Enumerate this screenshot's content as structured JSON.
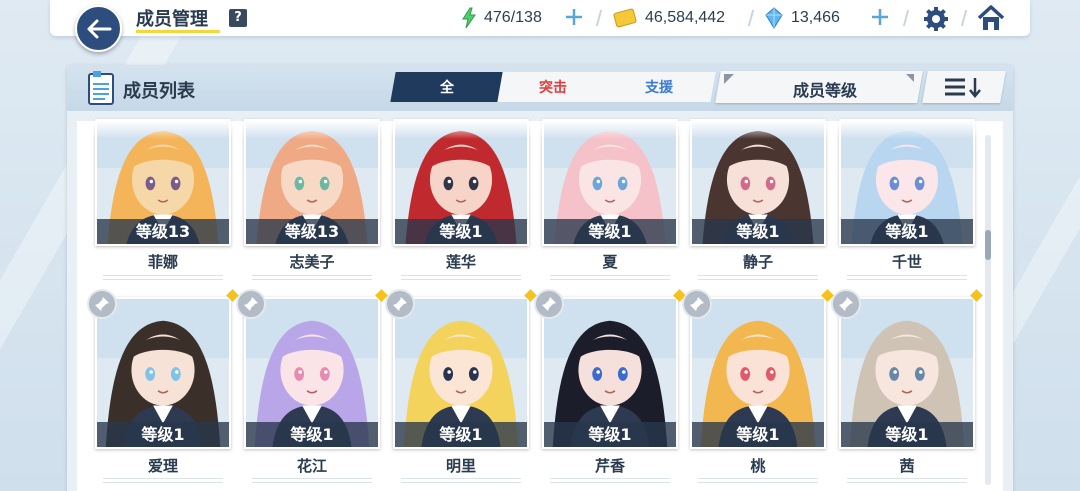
{
  "header": {
    "title": "成员管理",
    "help_label": "?",
    "stamina": "476/138",
    "credits": "46,584,442",
    "gems": "13,466",
    "back_icon": "arrow-left-icon",
    "settings_icon": "gear-icon",
    "home_icon": "home-icon"
  },
  "panel": {
    "title": "成员列表",
    "tabs": [
      {
        "label": "全",
        "active": true
      },
      {
        "label": "突击",
        "active": false
      },
      {
        "label": "支援",
        "active": false
      }
    ],
    "sort_label": "成员等级"
  },
  "members_row1": [
    {
      "name": "菲娜",
      "level": "等级13",
      "colors": [
        "#f3b45a",
        "#f6d7a8",
        "#7b5a8e"
      ]
    },
    {
      "name": "志美子",
      "level": "等级13",
      "colors": [
        "#f0a985",
        "#f8d9c6",
        "#6fb8a0"
      ]
    },
    {
      "name": "莲华",
      "level": "等级1",
      "colors": [
        "#c02a2e",
        "#f6d5c8",
        "#33344a"
      ]
    },
    {
      "name": "夏",
      "level": "等级1",
      "colors": [
        "#f4c2c8",
        "#fbe5e4",
        "#6aa7d8"
      ]
    },
    {
      "name": "静子",
      "level": "等级1",
      "colors": [
        "#4a3530",
        "#f6e0d8",
        "#d46a8a"
      ]
    },
    {
      "name": "千世",
      "level": "等级1",
      "colors": [
        "#b8d6f0",
        "#fbe6ea",
        "#6c8dd8"
      ]
    }
  ],
  "members_row2": [
    {
      "name": "爱理",
      "level": "等级1",
      "colors": [
        "#3b2f2a",
        "#f6e2d6",
        "#7ec3e8"
      ]
    },
    {
      "name": "花江",
      "level": "等级1",
      "colors": [
        "#b9a6e8",
        "#fbe4e8",
        "#e98bb0"
      ]
    },
    {
      "name": "明里",
      "level": "等级1",
      "colors": [
        "#f3d35c",
        "#fbe6d6",
        "#2c3350"
      ]
    },
    {
      "name": "芹香",
      "level": "等级1",
      "colors": [
        "#1c1d2a",
        "#f6e0dc",
        "#3a6bd0"
      ]
    },
    {
      "name": "桃",
      "level": "等级1",
      "colors": [
        "#f2b74f",
        "#fbe2d6",
        "#e25a6a"
      ]
    },
    {
      "name": "茜",
      "level": "等级1",
      "colors": [
        "#cfc3b6",
        "#f6e6de",
        "#6a87a8"
      ]
    }
  ]
}
